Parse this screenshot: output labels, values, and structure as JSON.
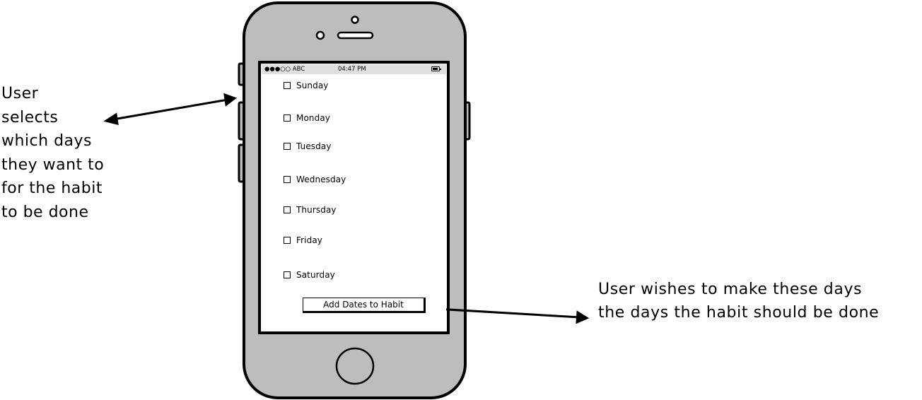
{
  "annotations": {
    "left_note": "User\nselects\nwhich days\nthey want to\nfor the habit\nto be done",
    "right_note": "User wishes to make these days\nthe days the habit should be done"
  },
  "status_bar": {
    "carrier": "●●●○○ ABC",
    "time": "04:47 PM"
  },
  "days": [
    {
      "label": "Sunday",
      "checked": false
    },
    {
      "label": "Monday",
      "checked": false
    },
    {
      "label": "Tuesday",
      "checked": false
    },
    {
      "label": "Wednesday",
      "checked": false
    },
    {
      "label": "Thursday",
      "checked": false
    },
    {
      "label": "Friday",
      "checked": false
    },
    {
      "label": "Saturday",
      "checked": false
    }
  ],
  "add_button_label": "Add Dates to Habit",
  "colors": {
    "phone_body": "#bdbdbd",
    "status_bar": "#e0e0e0",
    "outline": "#000000"
  }
}
